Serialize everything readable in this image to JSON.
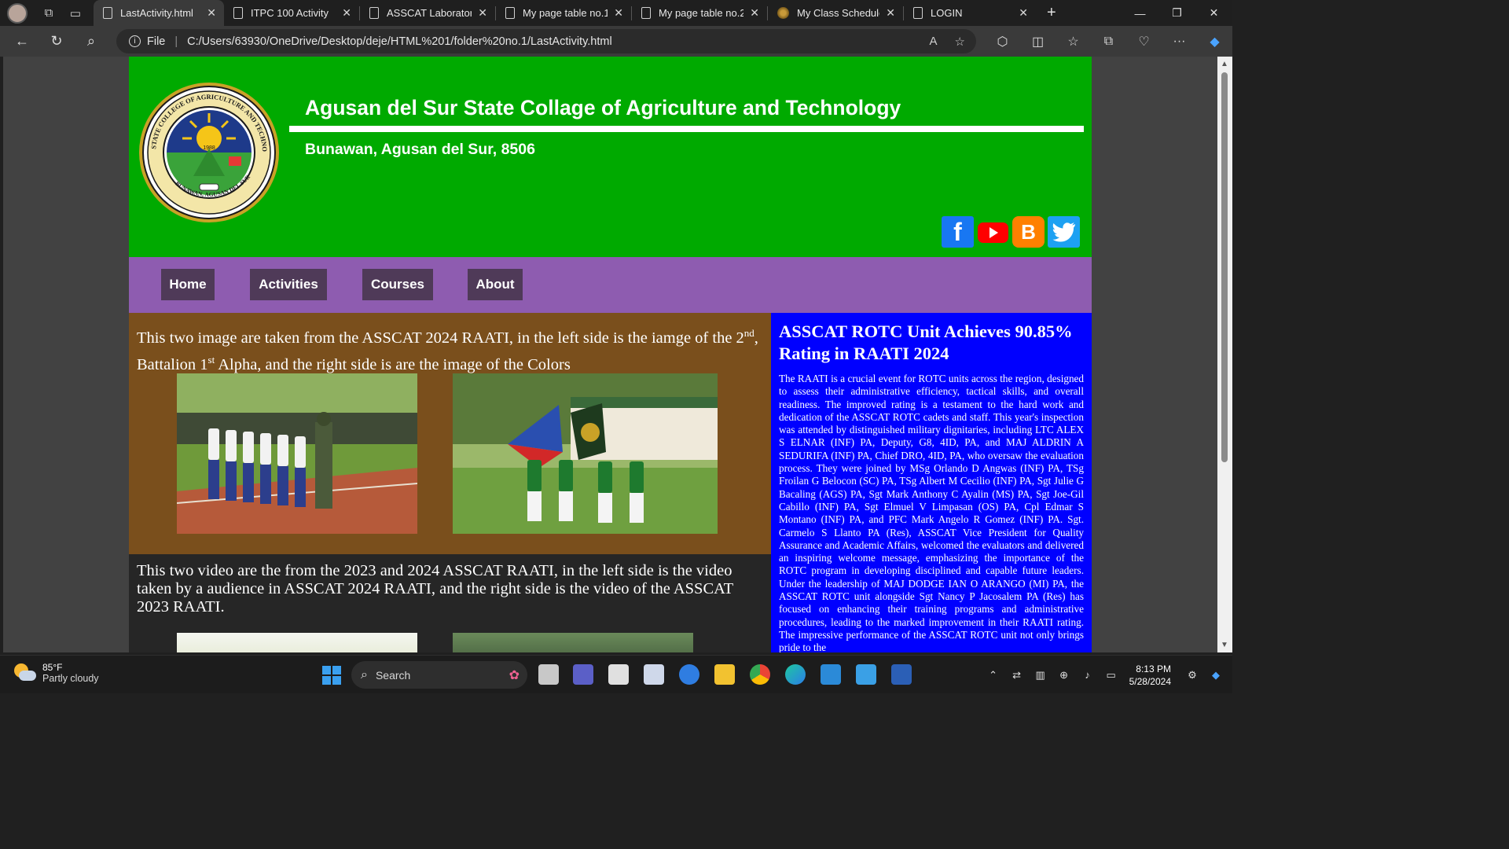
{
  "browser": {
    "tabs": [
      {
        "label": "LastActivity.html",
        "active": true
      },
      {
        "label": "ITPC 100 Activity",
        "active": false
      },
      {
        "label": "ASSCAT Laboratory",
        "active": false
      },
      {
        "label": "My page table no.1",
        "active": false
      },
      {
        "label": "My page table no.2",
        "active": false
      },
      {
        "label": "My Class Schedule",
        "active": false
      },
      {
        "label": "LOGIN",
        "active": false
      }
    ],
    "address": {
      "scheme_label": "File",
      "url": "C:/Users/63930/OneDrive/Desktop/deje/HTML%201/folder%20no.1/LastActivity.html"
    }
  },
  "site": {
    "school_name": "Agusan del Sur State Collage of Agriculture and Technology",
    "address": "Bunawan, Agusan del Sur, 8506",
    "logo": {
      "ring_text": "STATE COLLEGE OF AGRICULTURE AND TECHNOLOGY",
      "year": "1988",
      "bottom_text": "BUNAWAN, AGUSAN DEL SUR"
    },
    "socials": [
      "facebook-icon",
      "youtube-icon",
      "blogger-icon",
      "twitter-icon"
    ],
    "menu": [
      "Home",
      "Activities",
      "Courses",
      "About"
    ],
    "section1": {
      "text_a": "This two image are taken from the ASSCAT 2024 RAATI, in the left side is the iamge of the 2",
      "sup_a": "nd",
      "text_b": ", Battalion 1",
      "sup_b": "st",
      "text_c": " Alpha, and the right side is are the image of the Colors"
    },
    "section2": {
      "text": "This two video are the from the 2023 and 2024 ASSCAT RAATI, in the left side is the video taken by a audience in ASSCAT 2024 RAATI, and the right side is the video of the ASSCAT 2023 RAATI."
    },
    "article": {
      "title": "ASSCAT ROTC Unit Achieves 90.85% Rating in RAATI 2024",
      "body": "The RAATI is a crucial event for ROTC units across the region, designed to assess their administrative efficiency, tactical skills, and overall readiness. The improved rating is a testament to the hard work and dedication of the ASSCAT ROTC cadets and staff. This year's inspection was attended by distinguished military dignitaries, including LTC ALEX S ELNAR (INF) PA, Deputy, G8, 4ID, PA, and MAJ ALDRIN A SEDURIFA (INF) PA, Chief DRO, 4ID, PA, who oversaw the evaluation process. They were joined by MSg Orlando D Angwas (INF) PA, TSg Froilan G Belocon (SC) PA, TSg Albert M Cecilio (INF) PA, Sgt Julie G Bacaling (AGS) PA, Sgt Mark Anthony C Ayalin (MS) PA, Sgt Joe-Gil Cabillo (INF) PA, Sgt Elmuel V Limpasan (OS) PA, Cpl Edmar S Montano (INF) PA, and PFC Mark Angelo R Gomez (INF) PA. Sgt. Carmelo S Llanto PA (Res), ASSCAT Vice President for Quality Assurance and Academic Affairs, welcomed the evaluators and delivered an inspiring welcome message, emphasizing the importance of the ROTC program in developing disciplined and capable future leaders. Under the leadership of MAJ DODGE IAN O ARANGO (MI) PA, the ASSCAT ROTC unit alongside Sgt Nancy P Jacosalem PA (Res) has focused on enhancing their training programs and administrative procedures, leading to the marked improvement in their RAATI rating. The impressive performance of the ASSCAT ROTC unit not only brings pride to the"
    },
    "colors": {
      "header_green": "#00aa00",
      "menu_purple": "#8e5cb0",
      "menu_button": "#4f3a58",
      "brown_panel": "#7a4f1c",
      "article_blue": "#0000ff"
    }
  },
  "taskbar": {
    "weather_temp": "85°F",
    "weather_cond": "Partly cloudy",
    "search_label": "Search",
    "time": "8:13 PM",
    "date": "5/28/2024"
  }
}
